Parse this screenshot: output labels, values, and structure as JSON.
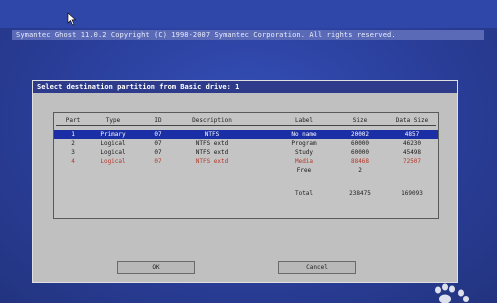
{
  "ghost": {
    "header_text": "Symantec Ghost 11.0.2   Copyright (C) 1998-2007 Symantec Corporation. All rights reserved."
  },
  "dialog": {
    "title": "Select destination partition from Basic drive: 1",
    "columns": [
      "Part",
      "Type",
      "ID",
      "Description",
      "Label",
      "Size",
      "Data Size"
    ],
    "rows": [
      {
        "part": "1",
        "type": "Primary",
        "id": "07",
        "description": "NTFS",
        "label": "No name",
        "size": "20002",
        "data_size": "4857",
        "selected": true
      },
      {
        "part": "2",
        "type": "Logical",
        "id": "07",
        "description": "NTFS extd",
        "label": "Program",
        "size": "60000",
        "data_size": "46230"
      },
      {
        "part": "3",
        "type": "Logical",
        "id": "07",
        "description": "NTFS extd",
        "label": "Study",
        "size": "60000",
        "data_size": "45498"
      },
      {
        "part": "4",
        "type": "Logical",
        "id": "07",
        "description": "NTFS extd",
        "label": "Media",
        "size": "88468",
        "data_size": "72507",
        "highlight": "red"
      }
    ],
    "free": {
      "label": "Free",
      "size": "2"
    },
    "total": {
      "label": "Total",
      "size": "238475",
      "data_size": "169093"
    },
    "ok_label": "OK",
    "cancel_label": "Cancel"
  },
  "colors": {
    "desktop": "#2b3f9e",
    "dialog_title_bg": "#2d3b8a",
    "selected_row": "#1a2ea6",
    "warning_text": "#b3392b"
  },
  "icons": [
    "mouse-cursor-icon",
    "paw-print-watermark-icon"
  ]
}
